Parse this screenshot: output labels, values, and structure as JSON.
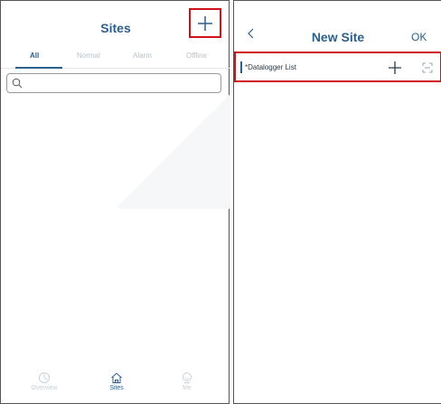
{
  "left_screen": {
    "title": "Sites",
    "tabs": [
      "All",
      "Normal",
      "Alarm",
      "Offline"
    ],
    "active_tab": "All",
    "search": {
      "placeholder": ""
    },
    "bottom_nav": [
      {
        "label": "Overview",
        "icon": "overview-icon",
        "active": false
      },
      {
        "label": "Sites",
        "icon": "home-icon",
        "active": true
      },
      {
        "label": "Me",
        "icon": "me-icon",
        "active": false
      }
    ]
  },
  "right_screen": {
    "title": "New Site",
    "ok_label": "OK",
    "datalogger_label": "*Datalogger List"
  },
  "colors": {
    "brand": "#2b5f8c",
    "highlight": "#d0121b",
    "muted": "#b6c1cb"
  }
}
